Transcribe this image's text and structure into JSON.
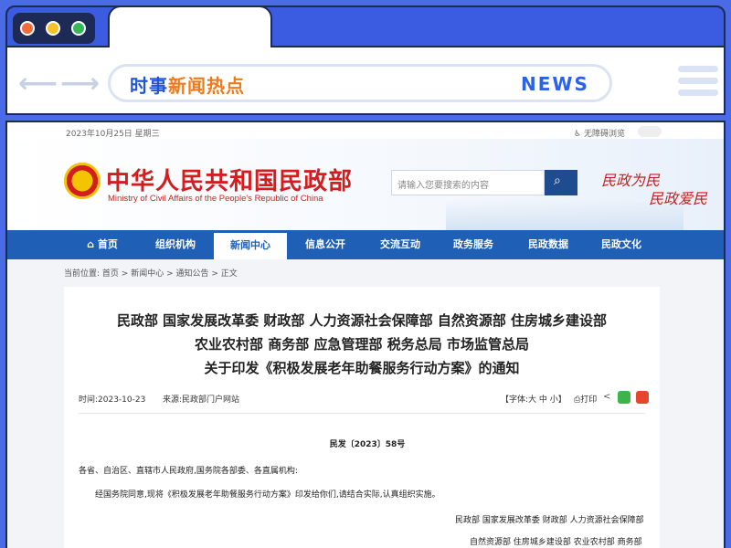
{
  "browser": {
    "headline_part1": "时事",
    "headline_part2": "新闻热点",
    "news_label": "NEWS",
    "colors": {
      "frame": "#4a6be6",
      "dark": "#1d2a55",
      "dot_red": "#f26b3a",
      "dot_yellow": "#f6c22b",
      "dot_green": "#35b85a"
    }
  },
  "site": {
    "date": "2023年10月25日 星期三",
    "accessibility": "无障碍浏览",
    "name_cn": "中华人民共和国民政部",
    "name_en": "Ministry of Civil Affairs of the People's Republic of China",
    "search_placeholder": "请输入您要搜索的内容",
    "slogan1": "民政为民",
    "slogan2": "民政爱民",
    "nav": [
      "首页",
      "组织机构",
      "新闻中心",
      "信息公开",
      "交流互动",
      "政务服务",
      "民政数据",
      "民政文化"
    ],
    "nav_active_index": 2
  },
  "breadcrumb": {
    "label": "当前位置:",
    "items": [
      "首页",
      "新闻中心",
      "通知公告",
      "正文"
    ]
  },
  "article": {
    "title_line1": "民政部 国家发展改革委 财政部 人力资源社会保障部 自然资源部 住房城乡建设部",
    "title_line2": "农业农村部 商务部 应急管理部 税务总局 市场监管总局",
    "title_line3": "关于印发《积极发展老年助餐服务行动方案》的通知",
    "time": "时间:2023-10-23",
    "source": "来源:民政部门户网站",
    "font_size": "【字体:大 中 小】",
    "print": "打印",
    "doc_number": "民发〔2023〕58号",
    "addressee": "各省、自治区、直辖市人民政府,国务院各部委、各直属机构:",
    "body1": "经国务院同意,现将《积极发展老年助餐服务行动方案》印发给你们,请结合实际,认真组织实施。",
    "sign1": "民政部 国家发展改革委 财政部 人力资源社会保障部",
    "sign2": "自然资源部 住房城乡建设部 农业农村部 商务部"
  }
}
